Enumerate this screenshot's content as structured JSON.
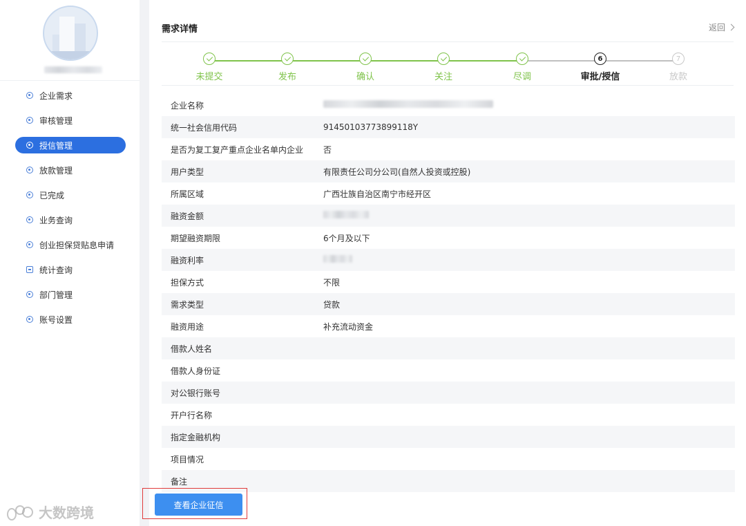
{
  "sidebar": {
    "menu": [
      {
        "label": "企业需求",
        "icon": "gear-icon",
        "active": false
      },
      {
        "label": "审核管理",
        "icon": "gear-icon",
        "active": false
      },
      {
        "label": "授信管理",
        "icon": "gear-icon",
        "active": true
      },
      {
        "label": "放款管理",
        "icon": "gear-icon",
        "active": false
      },
      {
        "label": "已完成",
        "icon": "target-icon",
        "active": false
      },
      {
        "label": "业务查询",
        "icon": "coin-icon",
        "active": false
      },
      {
        "label": "创业担保贷贴息申请",
        "icon": "target-icon",
        "active": false
      },
      {
        "label": "统计查询",
        "icon": "edit-icon",
        "active": false
      },
      {
        "label": "部门管理",
        "icon": "gear-icon",
        "active": false
      },
      {
        "label": "账号设置",
        "icon": "gear-icon",
        "active": false
      }
    ]
  },
  "header": {
    "title": "需求详情",
    "back_label": "返回"
  },
  "steps": [
    {
      "label": "未提交",
      "status": "done",
      "number": ""
    },
    {
      "label": "发布",
      "status": "done",
      "number": ""
    },
    {
      "label": "确认",
      "status": "done",
      "number": ""
    },
    {
      "label": "关注",
      "status": "done",
      "number": ""
    },
    {
      "label": "尽调",
      "status": "done",
      "number": ""
    },
    {
      "label": "审批/授信",
      "status": "current",
      "number": "6"
    },
    {
      "label": "放款",
      "status": "pending",
      "number": "7"
    }
  ],
  "details": [
    {
      "label": "企业名称",
      "value": ""
    },
    {
      "label": "统一社会信用代码",
      "value": "91450103773899118Y"
    },
    {
      "label": "是否为复工复产重点企业名单内企业",
      "value": "否"
    },
    {
      "label": "用户类型",
      "value": "有限责任公司分公司(自然人投资或控股)"
    },
    {
      "label": "所属区域",
      "value": "广西壮族自治区南宁市经开区"
    },
    {
      "label": "融资金额",
      "value": ""
    },
    {
      "label": "期望融资期限",
      "value": "6个月及以下"
    },
    {
      "label": "融资利率",
      "value": ""
    },
    {
      "label": "担保方式",
      "value": "不限"
    },
    {
      "label": "需求类型",
      "value": "贷款"
    },
    {
      "label": "融资用途",
      "value": "补充流动资金"
    },
    {
      "label": "借款人姓名",
      "value": ""
    },
    {
      "label": "借款人身份证",
      "value": ""
    },
    {
      "label": "对公银行账号",
      "value": ""
    },
    {
      "label": "开户行名称",
      "value": ""
    },
    {
      "label": "指定金融机构",
      "value": ""
    },
    {
      "label": "项目情况",
      "value": ""
    },
    {
      "label": "备注",
      "value": ""
    }
  ],
  "actions": {
    "view_credit_label": "查看企业征信"
  },
  "watermark": {
    "text": "大数跨境"
  },
  "colors": {
    "primary": "#2c6fe0",
    "step_done": "#7fc34a",
    "button": "#3d8ff0",
    "highlight_border": "#e03a3a"
  }
}
